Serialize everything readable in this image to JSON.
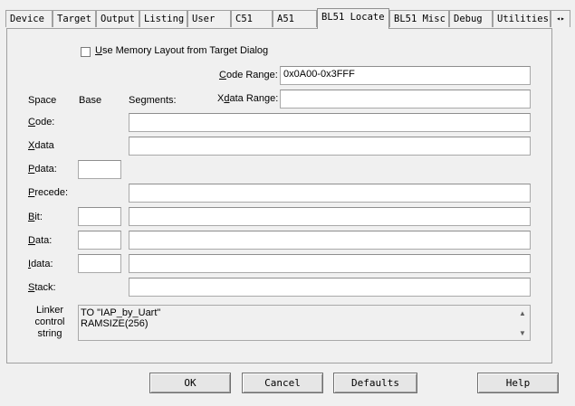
{
  "tabs": [
    "Device",
    "Target",
    "Output",
    "Listing",
    "User",
    "C51",
    "A51",
    "BL51 Locate",
    "BL51 Misc",
    "Debug",
    "Utilities"
  ],
  "active_tab": "BL51 Locate",
  "use_memory_layout": {
    "label_accel": "U",
    "label_rest": "se Memory Layout from Target Dialog",
    "checked": false
  },
  "code_range": {
    "label_accel": "C",
    "label_rest": "ode Range:",
    "value": "0x0A00-0x3FFF"
  },
  "xdata_range": {
    "label_pre": "X",
    "label_accel": "d",
    "label_rest": "ata Range:",
    "value": ""
  },
  "headers": {
    "space": "Space",
    "base": "Base",
    "segments": "Segments:"
  },
  "rows": {
    "code": {
      "accel": "C",
      "rest": "ode:"
    },
    "xdata": {
      "accel": "X",
      "rest": "data"
    },
    "pdata": {
      "accel": "P",
      "rest": "data:"
    },
    "precede": {
      "accel": "P",
      "rest": "recede:"
    },
    "bit": {
      "accel": "B",
      "rest": "it:"
    },
    "data": {
      "accel": "D",
      "rest": "ata:"
    },
    "idata": {
      "accel": "I",
      "rest": "data:"
    },
    "stack": {
      "accel": "S",
      "rest": "tack:"
    }
  },
  "linker": {
    "label_line1": "Linker",
    "label_line2": "control",
    "label_line3": "string",
    "line1": "TO \"IAP_by_Uart\"",
    "line2": "RAMSIZE(256)"
  },
  "buttons": {
    "ok": "OK",
    "cancel": "Cancel",
    "defaults": "Defaults",
    "help": "Help"
  }
}
